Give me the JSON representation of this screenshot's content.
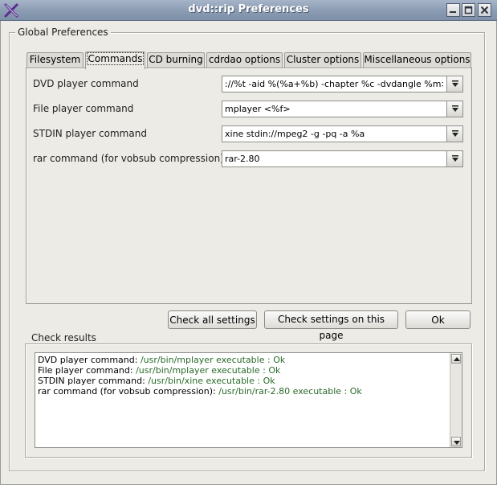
{
  "window": {
    "title": "dvd::rip Preferences",
    "icons": {
      "logo": "x-logo-icon",
      "minimize": "minimize-icon",
      "maximize": "maximize-icon",
      "close": "close-icon"
    }
  },
  "global_group": {
    "label": "Global Preferences"
  },
  "tabs": [
    {
      "label": "Filesystem",
      "active": false
    },
    {
      "label": "Commands",
      "active": true
    },
    {
      "label": "CD burning",
      "active": false
    },
    {
      "label": "cdrdao options",
      "active": false
    },
    {
      "label": "Cluster options",
      "active": false
    },
    {
      "label": "Miscellaneous options",
      "active": false
    }
  ],
  "commands": [
    {
      "label": "DVD player command",
      "value": "://%t -aid %(%a+%b) -chapter %c -dvdangle %m>"
    },
    {
      "label": "File player command",
      "value": "mplayer <%f>"
    },
    {
      "label": "STDIN player command",
      "value": "xine stdin://mpeg2 -g -pq -a %a"
    },
    {
      "label": "rar command (for vobsub compression)",
      "value": "rar-2.80"
    }
  ],
  "buttons": {
    "check_all": "Check all settings",
    "check_page": "Check settings on this page",
    "ok": "Ok"
  },
  "check_results": {
    "label": "Check results",
    "lines": [
      {
        "prefix": "DVD player command: ",
        "result": "/usr/bin/mplayer executable : Ok"
      },
      {
        "prefix": "File player command: ",
        "result": "/usr/bin/mplayer executable : Ok"
      },
      {
        "prefix": "STDIN player command: ",
        "result": "/usr/bin/xine executable : Ok"
      },
      {
        "prefix": "rar command (for vobsub compression): ",
        "result": "/usr/bin/rar-2.80 executable : Ok"
      }
    ]
  },
  "colors": {
    "titlebar": "#8a9bb2",
    "ok_text": "#2a6a2a",
    "window_bg": "#ecebe6"
  }
}
